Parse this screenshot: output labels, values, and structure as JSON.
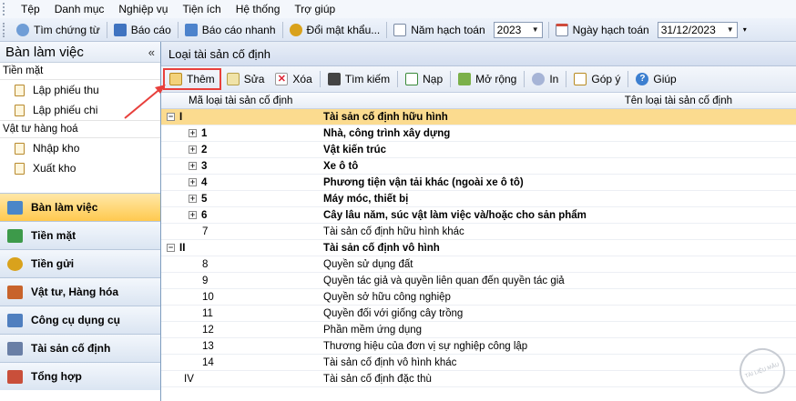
{
  "menu": [
    "Tệp",
    "Danh mục",
    "Nghiệp vụ",
    "Tiện ích",
    "Hệ thống",
    "Trợ giúp"
  ],
  "toolbar": {
    "tim_chung_tu": "Tìm chứng từ",
    "bao_cao": "Báo cáo",
    "bao_cao_nhanh": "Báo cáo nhanh",
    "doi_mat_khau": "Đổi mật khẩu...",
    "nam_hach_toan_label": "Năm hạch toán",
    "nam_hach_toan_value": "2023",
    "ngay_hach_toan_label": "Ngày hạch toán",
    "ngay_hach_toan_value": "31/12/2023"
  },
  "sidebar": {
    "title": "Bàn làm việc",
    "groups": [
      {
        "label": "Tiền mặt",
        "items": [
          "Lập phiếu thu",
          "Lập phiếu chi"
        ]
      },
      {
        "label": "Vật tư hàng hoá",
        "items": [
          "Nhập kho",
          "Xuất kho"
        ]
      }
    ],
    "nav": [
      {
        "label": "Bàn làm việc",
        "active": true,
        "color": "#4a86c8"
      },
      {
        "label": "Tiền mặt",
        "active": false,
        "color": "#3d9a4a"
      },
      {
        "label": "Tiền gửi",
        "active": false,
        "color": "#d9a21c"
      },
      {
        "label": "Vật tư, Hàng hóa",
        "active": false,
        "color": "#c8632b"
      },
      {
        "label": "Công cụ dụng cụ",
        "active": false,
        "color": "#4f7fbf"
      },
      {
        "label": "Tài sản cố định",
        "active": false,
        "color": "#6a7fa6"
      },
      {
        "label": "Tổng hợp",
        "active": false,
        "color": "#c94f3a"
      }
    ]
  },
  "main": {
    "title": "Loại tài sản cố định",
    "actions": {
      "them": "Thêm",
      "sua": "Sửa",
      "xoa": "Xóa",
      "tim_kiem": "Tìm kiếm",
      "nap": "Nạp",
      "mo_rong": "Mở rộng",
      "in": "In",
      "gop_y": "Góp ý",
      "giup": "Giúp"
    },
    "columns": {
      "code": "Mã loại tài sản cố định",
      "name": "Tên loại tài sản cố định"
    },
    "rows": [
      {
        "code": "I",
        "name": "Tài sản cố định hữu hình",
        "level": 0,
        "bold": true,
        "toggle": "−",
        "selected": true
      },
      {
        "code": "1",
        "name": "Nhà, công trình xây dựng",
        "level": 1,
        "bold": true,
        "toggle": "+"
      },
      {
        "code": "2",
        "name": "Vật kiến trúc",
        "level": 1,
        "bold": true,
        "toggle": "+"
      },
      {
        "code": "3",
        "name": "Xe ô tô",
        "level": 1,
        "bold": true,
        "toggle": "+"
      },
      {
        "code": "4",
        "name": "Phương tiện vận tải khác (ngoài xe ô tô)",
        "level": 1,
        "bold": true,
        "toggle": "+"
      },
      {
        "code": "5",
        "name": "Máy móc, thiết bị",
        "level": 1,
        "bold": true,
        "toggle": "+"
      },
      {
        "code": "6",
        "name": "Cây lâu năm, súc vật làm việc và/hoặc cho sản phẩm",
        "level": 1,
        "bold": true,
        "toggle": "+"
      },
      {
        "code": "7",
        "name": "Tài sản cố định hữu hình khác",
        "level": 1,
        "bold": false,
        "toggle": ""
      },
      {
        "code": "II",
        "name": "Tài sản cố định vô hình",
        "level": 0,
        "bold": true,
        "toggle": "−"
      },
      {
        "code": "8",
        "name": "Quyền sử dụng đất",
        "level": 1,
        "bold": false,
        "toggle": ""
      },
      {
        "code": "9",
        "name": "Quyền tác giả và quyền liên quan đến quyền tác giả",
        "level": 1,
        "bold": false,
        "toggle": ""
      },
      {
        "code": "10",
        "name": "Quyền sở hữu công nghiệp",
        "level": 1,
        "bold": false,
        "toggle": ""
      },
      {
        "code": "11",
        "name": "Quyền đối với giống cây trồng",
        "level": 1,
        "bold": false,
        "toggle": ""
      },
      {
        "code": "12",
        "name": "Phần mềm ứng dụng",
        "level": 1,
        "bold": false,
        "toggle": ""
      },
      {
        "code": "13",
        "name": "Thương hiệu của đơn vị sự nghiệp công lập",
        "level": 1,
        "bold": false,
        "toggle": ""
      },
      {
        "code": "14",
        "name": "Tài sản cố định vô hình khác",
        "level": 1,
        "bold": false,
        "toggle": ""
      },
      {
        "code": "IV",
        "name": "Tài sản cố định đặc thù",
        "level": 0,
        "bold": false,
        "toggle": ""
      }
    ]
  },
  "watermark": "TÀI LIỆU MẪU"
}
